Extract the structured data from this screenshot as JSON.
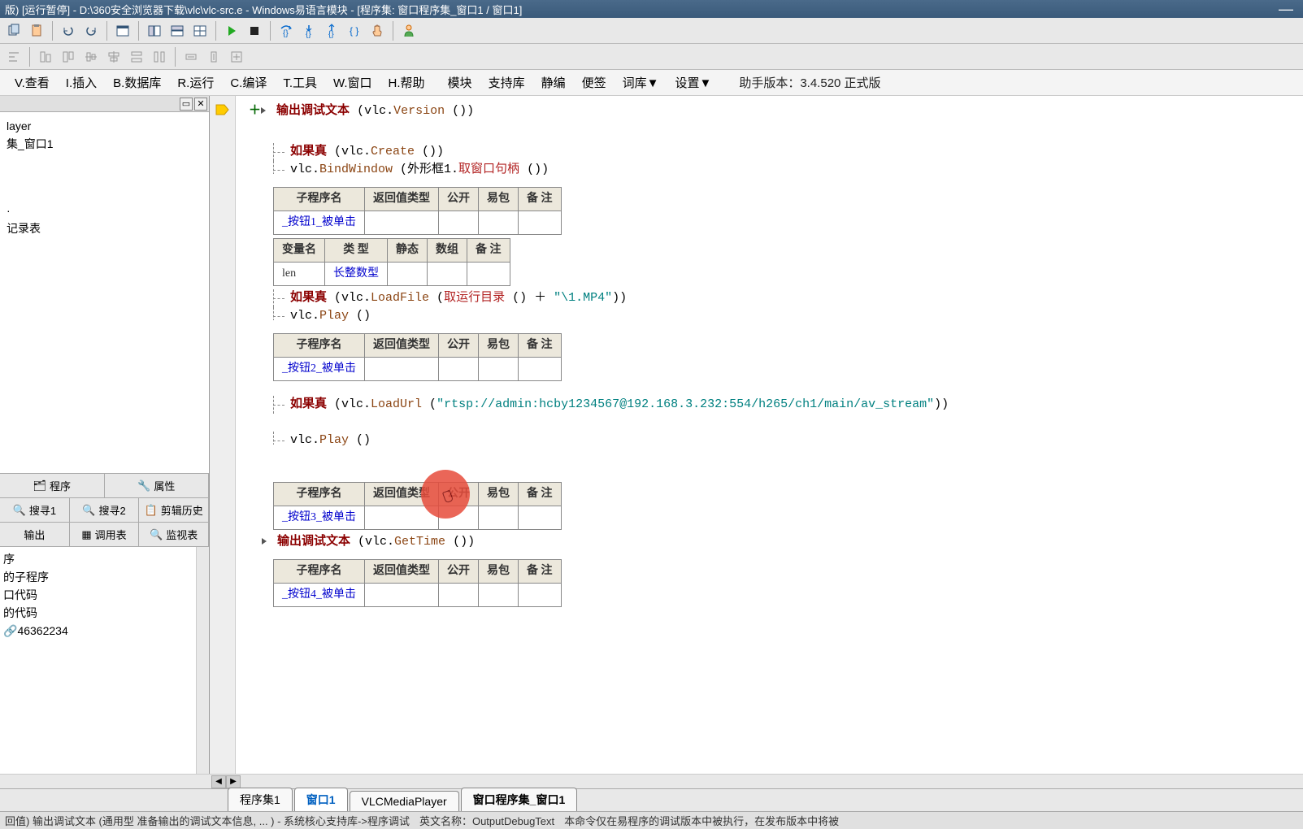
{
  "title": "版) [运行暂停] - D:\\360安全浏览器下载\\vlc\\vlc-src.e - Windows易语言模块 - [程序集: 窗口程序集_窗口1 / 窗口1]",
  "menu": {
    "view": "V.查看",
    "insert": "I.插入",
    "database": "B.数据库",
    "run": "R.运行",
    "compile": "C.编译",
    "tool": "T.工具",
    "window": "W.窗口",
    "help": "H.帮助",
    "module": "模块",
    "support": "支持库",
    "quiet": "静编",
    "note": "便签",
    "dict": "词库▼",
    "settings": "设置▼",
    "assistant": "助手版本：3.4.520 正式版"
  },
  "tree": {
    "n1": "layer",
    "n2": "集_窗口1",
    "n3": "·",
    "n4": "记录表"
  },
  "proptabs": {
    "t1": "程序",
    "t2": "属性"
  },
  "searchtabs": {
    "s1": "搜寻1",
    "s2": "搜寻2",
    "s3": "剪辑历史",
    "s4": "输出",
    "s5": "调用表",
    "s6": "监视表"
  },
  "proplist": {
    "p1": "序",
    "p2": "的子程序",
    "p3": "口代码",
    "p4": "的代码",
    "p5": "46362234"
  },
  "code": {
    "out1a": "输出调试文本",
    "out1b": "(vlc.",
    "out1c": "Version",
    "out1d": " ())",
    "if1a": "如果真",
    "if1b": " (vlc.",
    "if1c": "Create",
    "if1d": " ())",
    "bind1a": "vlc.",
    "bind1b": "BindWindow",
    "bind1c": " (外形框1.",
    "bind1d": "取窗口句柄",
    "bind1e": " ())",
    "if2a": "如果真",
    "if2b": " (vlc.",
    "if2c": "LoadFile",
    "if2d": " (",
    "if2e": "取运行目录",
    "if2f": " () ＋ ",
    "if2g": "\"\\1.MP4\"",
    "if2h": "))",
    "play1a": "vlc.",
    "play1b": "Play",
    "play1c": " ()",
    "if3a": "如果真",
    "if3b": " (vlc.",
    "if3c": "LoadUrl",
    "if3d": " (",
    "if3e": "\"rtsp://admin:hcby1234567@192.168.3.232:554/h265/ch1/main/av_stream\"",
    "if3f": "))",
    "play2a": "vlc.",
    "play2b": "Play",
    "play2c": " ()",
    "out2a": "输出调试文本",
    "out2b": " (vlc.",
    "out2c": "GetTime",
    "out2d": " ())"
  },
  "tables": {
    "headers": {
      "h1": "子程序名",
      "h2": "返回值类型",
      "h3": "公开",
      "h4": "易包",
      "h5": "备 注"
    },
    "varheaders": {
      "v1": "变量名",
      "v2": "类 型",
      "v3": "静态",
      "v4": "数组",
      "v5": "备 注"
    },
    "sub1": "_按钮1_被单击",
    "sub2": "_按钮2_被单击",
    "sub3": "_按钮3_被单击",
    "sub4": "_按钮4_被单击",
    "var1name": "len",
    "var1type": "长整数型"
  },
  "bottomtabs": {
    "t1": "程序集1",
    "t2": "窗口1",
    "t3": "VLCMediaPlayer",
    "t4": "窗口程序集_窗口1"
  },
  "status": {
    "s1": "回值)   输出调试文本 (通用型 准备输出的调试文本信息, ... ) - 系统核心支持库->程序调试",
    "s2": "英文名称：OutputDebugText",
    "s3": "本命令仅在易程序的调试版本中被执行，在发布版本中将被"
  }
}
